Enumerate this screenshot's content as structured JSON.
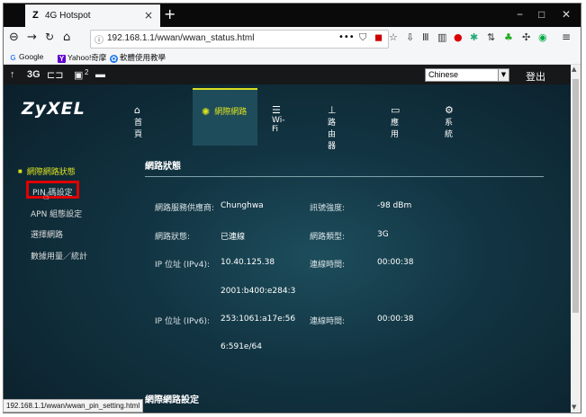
{
  "browser": {
    "tab_title": "4G Hotspot",
    "tab_favicon": "Z",
    "tab_close": "×",
    "new_tab": "+",
    "win_min": "−",
    "win_max": "□",
    "win_close": "✕",
    "url": "192.168.1.1/wwan/wwan_status.html",
    "url_more": "•••",
    "status_url": "192.168.1.1/wwan/wwan_pin_setting.html",
    "bookmarks": [
      {
        "label": "Google",
        "icon": "google-icon",
        "glyph": "G",
        "color": "#4285f4"
      },
      {
        "label": "Yahoo!奇摩",
        "icon": "yahoo-icon",
        "glyph": "Y",
        "color": "#5f01d1"
      },
      {
        "label": "軟體使用教學",
        "icon": "globe-icon",
        "glyph": "✿",
        "color": "#1a73e8"
      }
    ]
  },
  "statusbar": {
    "signal_glyph": "↑",
    "network": "3G",
    "sms_count": "2",
    "language": "Chinese",
    "logout": "登出"
  },
  "brand": {
    "logo": "ZyXEL"
  },
  "menu": [
    {
      "label": "首頁",
      "icon": "home-icon",
      "glyph": "⌂"
    },
    {
      "label": "網際網路",
      "icon": "globe-icon",
      "glyph": "✺",
      "active": true
    },
    {
      "label": "Wi-Fi",
      "icon": "wifi-icon",
      "glyph": "☰"
    },
    {
      "label": "路由器",
      "icon": "router-icon",
      "glyph": "⊥"
    },
    {
      "label": "應用",
      "icon": "monitor-icon",
      "glyph": "▭"
    },
    {
      "label": "系統",
      "icon": "gears-icon",
      "glyph": "⚙"
    }
  ],
  "sidebar": [
    {
      "label": "網際網路狀態",
      "active": true
    },
    {
      "label": "PIN 碼設定"
    },
    {
      "label": "APN 組態設定"
    },
    {
      "label": "選擇網路"
    },
    {
      "label": "數據用量／統計"
    }
  ],
  "status": {
    "title": "網路狀態",
    "provider_label": "網路服務供應商:",
    "provider": "Chunghwa",
    "signal_label": "訊號強度:",
    "signal": "-98 dBm",
    "net_status_label": "網路狀態:",
    "net_status": "已連線",
    "net_type_label": "網路類型:",
    "net_type": "3G",
    "ipv4_label": "IP 位址 (IPv4):",
    "ipv4": "10.40.125.38",
    "ipv4_time_label": "連線時間:",
    "ipv4_time": "00:00:38",
    "ipv6_gw": "2001:b400:e284:3",
    "ipv6_label": "IP 位址 (IPv6):",
    "ipv6": "253:1061:a17e:56",
    "ipv6_time_label": "連線時間:",
    "ipv6_time": "00:00:38",
    "ipv6_suffix": "6:591e/64"
  },
  "lan": {
    "title": "網際網路設定"
  }
}
